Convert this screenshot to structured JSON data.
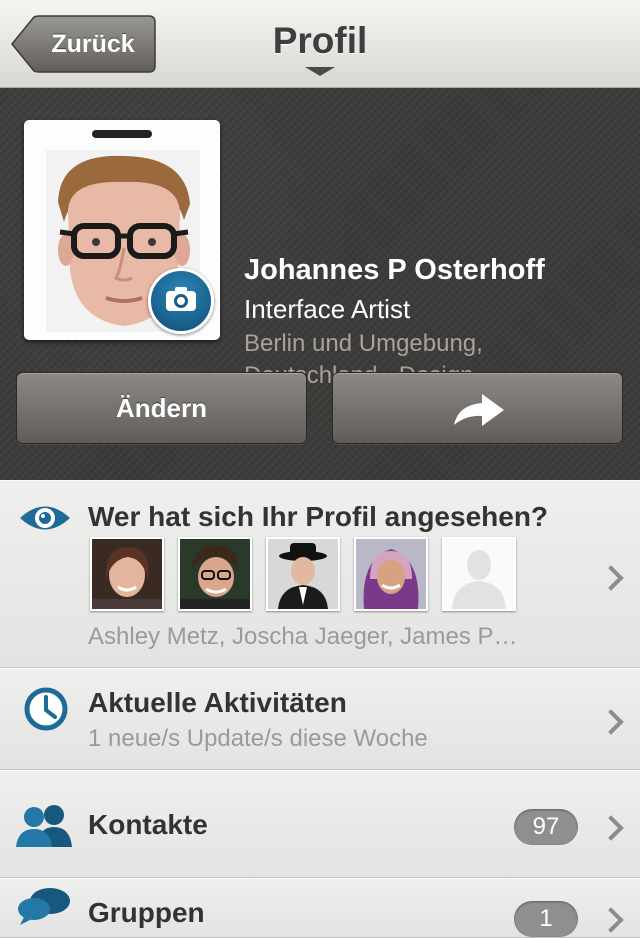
{
  "nav": {
    "back_label": "Zurück",
    "title": "Profil"
  },
  "profile": {
    "name": "Johannes P Osterhoff",
    "headline": "Interface Artist",
    "location_line1": "Berlin und Umgebung,",
    "location_line2": "Deutschland · Design",
    "edit_label": "Ändern",
    "share_icon": "share-arrow-icon",
    "camera_icon": "camera-icon"
  },
  "viewers": {
    "title": "Wer hat sich Ihr Profil angesehen?",
    "names": "Ashley Metz, Joscha Jaeger, James P…",
    "thumbs": [
      "woman-smiling",
      "man-glasses",
      "man-hat",
      "woman-headscarf",
      "anonymous-silhouette"
    ]
  },
  "activity": {
    "title": "Aktuelle Aktivitäten",
    "subtitle": "1 neue/s Update/s diese Woche"
  },
  "contacts": {
    "title": "Kontakte",
    "count": "97"
  },
  "groups": {
    "title": "Gruppen",
    "count": "1"
  },
  "colors": {
    "accent_blue": "#1e6b99",
    "header_dark": "#3d3b39"
  }
}
